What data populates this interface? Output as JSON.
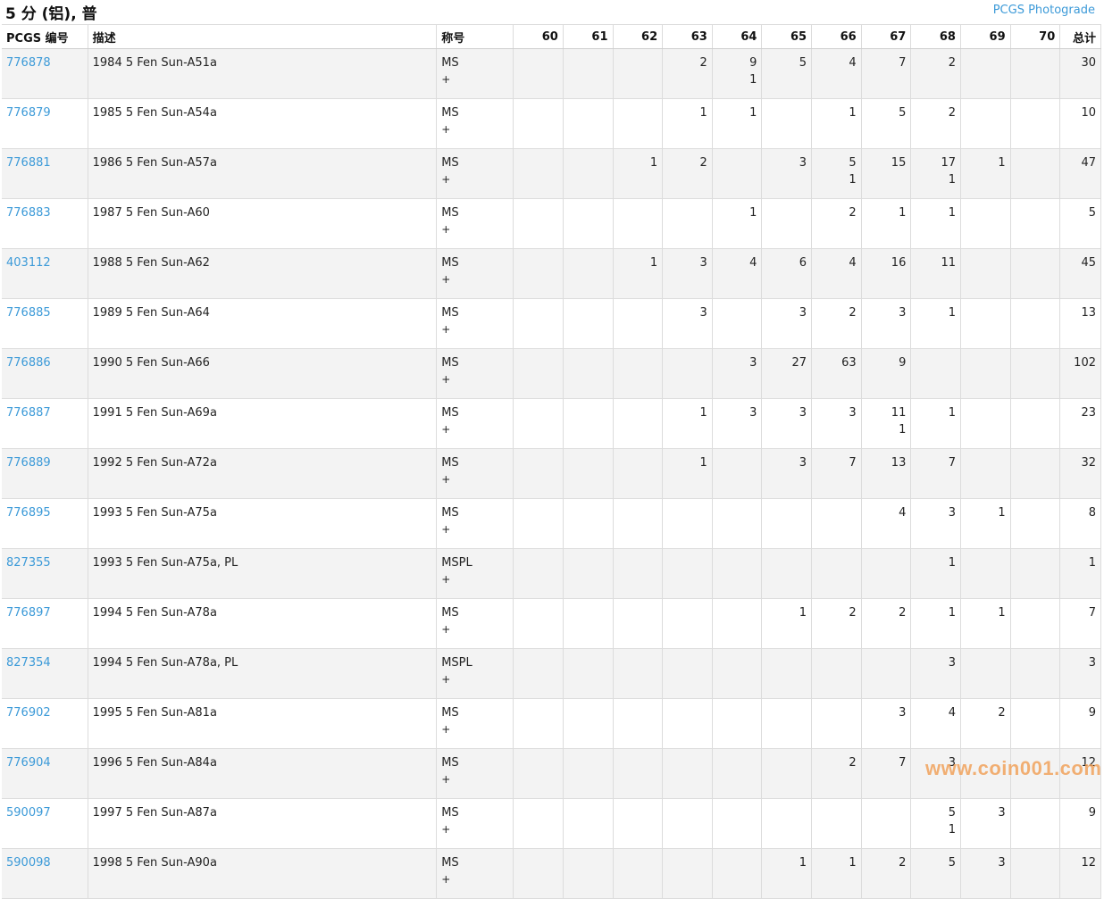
{
  "header": {
    "title": "5 分 (铝), 普",
    "photograde_link": "PCGS Photograde"
  },
  "table": {
    "columns": {
      "pcgs_no": "PCGS 编号",
      "description": "描述",
      "designation": "称号",
      "grades": [
        "60",
        "61",
        "62",
        "63",
        "64",
        "65",
        "66",
        "67",
        "68",
        "69",
        "70"
      ],
      "total": "总计"
    },
    "rows": [
      {
        "id": "776878",
        "desc": "1984 5 Fen Sun-A51a",
        "des": "MS",
        "plus": "+",
        "g": [
          "",
          "",
          "",
          "2",
          "9",
          "5",
          "4",
          "7",
          "2",
          "",
          ""
        ],
        "p": [
          "",
          "",
          "",
          "",
          "1",
          "",
          "",
          "",
          "",
          "",
          ""
        ],
        "total": "30"
      },
      {
        "id": "776879",
        "desc": "1985 5 Fen Sun-A54a",
        "des": "MS",
        "plus": "+",
        "g": [
          "",
          "",
          "",
          "1",
          "1",
          "",
          "1",
          "5",
          "2",
          "",
          ""
        ],
        "p": [
          "",
          "",
          "",
          "",
          "",
          "",
          "",
          "",
          "",
          "",
          ""
        ],
        "total": "10"
      },
      {
        "id": "776881",
        "desc": "1986 5 Fen Sun-A57a",
        "des": "MS",
        "plus": "+",
        "g": [
          "",
          "",
          "1",
          "2",
          "",
          "3",
          "5",
          "15",
          "17",
          "1",
          ""
        ],
        "p": [
          "",
          "",
          "",
          "",
          "",
          "",
          "1",
          "",
          "1",
          "",
          ""
        ],
        "total": "47"
      },
      {
        "id": "776883",
        "desc": "1987 5 Fen Sun-A60",
        "des": "MS",
        "plus": "+",
        "g": [
          "",
          "",
          "",
          "",
          "1",
          "",
          "2",
          "1",
          "1",
          "",
          ""
        ],
        "p": [
          "",
          "",
          "",
          "",
          "",
          "",
          "",
          "",
          "",
          "",
          ""
        ],
        "total": "5"
      },
      {
        "id": "403112",
        "desc": "1988 5 Fen Sun-A62",
        "des": "MS",
        "plus": "+",
        "g": [
          "",
          "",
          "1",
          "3",
          "4",
          "6",
          "4",
          "16",
          "11",
          "",
          ""
        ],
        "p": [
          "",
          "",
          "",
          "",
          "",
          "",
          "",
          "",
          "",
          "",
          ""
        ],
        "total": "45"
      },
      {
        "id": "776885",
        "desc": "1989 5 Fen Sun-A64",
        "des": "MS",
        "plus": "+",
        "g": [
          "",
          "",
          "",
          "3",
          "",
          "3",
          "2",
          "3",
          "1",
          "",
          ""
        ],
        "p": [
          "",
          "",
          "",
          "",
          "",
          "",
          "",
          "",
          "",
          "",
          ""
        ],
        "total": "13"
      },
      {
        "id": "776886",
        "desc": "1990 5 Fen Sun-A66",
        "des": "MS",
        "plus": "+",
        "g": [
          "",
          "",
          "",
          "",
          "3",
          "27",
          "63",
          "9",
          "",
          "",
          ""
        ],
        "p": [
          "",
          "",
          "",
          "",
          "",
          "",
          "",
          "",
          "",
          "",
          ""
        ],
        "total": "102"
      },
      {
        "id": "776887",
        "desc": "1991 5 Fen Sun-A69a",
        "des": "MS",
        "plus": "+",
        "g": [
          "",
          "",
          "",
          "1",
          "3",
          "3",
          "3",
          "11",
          "1",
          "",
          ""
        ],
        "p": [
          "",
          "",
          "",
          "",
          "",
          "",
          "",
          "1",
          "",
          "",
          ""
        ],
        "total": "23"
      },
      {
        "id": "776889",
        "desc": "1992 5 Fen Sun-A72a",
        "des": "MS",
        "plus": "+",
        "g": [
          "",
          "",
          "",
          "1",
          "",
          "3",
          "7",
          "13",
          "7",
          "",
          ""
        ],
        "p": [
          "",
          "",
          "",
          "",
          "",
          "",
          "",
          "",
          "",
          "",
          ""
        ],
        "total": "32"
      },
      {
        "id": "776895",
        "desc": "1993 5 Fen Sun-A75a",
        "des": "MS",
        "plus": "+",
        "g": [
          "",
          "",
          "",
          "",
          "",
          "",
          "",
          "4",
          "3",
          "1",
          ""
        ],
        "p": [
          "",
          "",
          "",
          "",
          "",
          "",
          "",
          "",
          "",
          "",
          ""
        ],
        "total": "8"
      },
      {
        "id": "827355",
        "desc": "1993 5 Fen Sun-A75a, PL",
        "des": "MSPL",
        "plus": "+",
        "g": [
          "",
          "",
          "",
          "",
          "",
          "",
          "",
          "",
          "1",
          "",
          ""
        ],
        "p": [
          "",
          "",
          "",
          "",
          "",
          "",
          "",
          "",
          "",
          "",
          ""
        ],
        "total": "1"
      },
      {
        "id": "776897",
        "desc": "1994 5 Fen Sun-A78a",
        "des": "MS",
        "plus": "+",
        "g": [
          "",
          "",
          "",
          "",
          "",
          "1",
          "2",
          "2",
          "1",
          "1",
          ""
        ],
        "p": [
          "",
          "",
          "",
          "",
          "",
          "",
          "",
          "",
          "",
          "",
          ""
        ],
        "total": "7"
      },
      {
        "id": "827354",
        "desc": "1994 5 Fen Sun-A78a, PL",
        "des": "MSPL",
        "plus": "+",
        "g": [
          "",
          "",
          "",
          "",
          "",
          "",
          "",
          "",
          "3",
          "",
          ""
        ],
        "p": [
          "",
          "",
          "",
          "",
          "",
          "",
          "",
          "",
          "",
          "",
          ""
        ],
        "total": "3"
      },
      {
        "id": "776902",
        "desc": "1995 5 Fen Sun-A81a",
        "des": "MS",
        "plus": "+",
        "g": [
          "",
          "",
          "",
          "",
          "",
          "",
          "",
          "3",
          "4",
          "2",
          ""
        ],
        "p": [
          "",
          "",
          "",
          "",
          "",
          "",
          "",
          "",
          "",
          "",
          ""
        ],
        "total": "9"
      },
      {
        "id": "776904",
        "desc": "1996 5 Fen Sun-A84a",
        "des": "MS",
        "plus": "+",
        "g": [
          "",
          "",
          "",
          "",
          "",
          "",
          "2",
          "7",
          "3",
          "",
          ""
        ],
        "p": [
          "",
          "",
          "",
          "",
          "",
          "",
          "",
          "",
          "",
          "",
          ""
        ],
        "total": "12"
      },
      {
        "id": "590097",
        "desc": "1997 5 Fen Sun-A87a",
        "des": "MS",
        "plus": "+",
        "g": [
          "",
          "",
          "",
          "",
          "",
          "",
          "",
          "",
          "5",
          "3",
          ""
        ],
        "p": [
          "",
          "",
          "",
          "",
          "",
          "",
          "",
          "",
          "1",
          "",
          ""
        ],
        "total": "9"
      },
      {
        "id": "590098",
        "desc": "1998 5 Fen Sun-A90a",
        "des": "MS",
        "plus": "+",
        "g": [
          "",
          "",
          "",
          "",
          "",
          "1",
          "1",
          "2",
          "5",
          "3",
          ""
        ],
        "p": [
          "",
          "",
          "",
          "",
          "",
          "",
          "",
          "",
          "",
          "",
          ""
        ],
        "total": "12"
      }
    ]
  },
  "watermark": "www.coin001.com",
  "colors": {
    "link": "#3c9ad8",
    "row_alt": "#f3f3f3",
    "border": "#dcdcdc",
    "watermark": "#f1a35c"
  }
}
